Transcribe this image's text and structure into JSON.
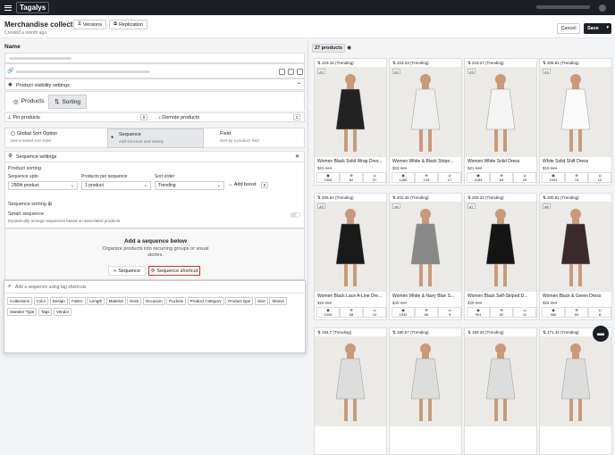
{
  "topbar": {
    "brand": "Tagalys"
  },
  "header": {
    "title": "Merchandise collection",
    "subtitle": "Created a month ago",
    "versions": "Versions",
    "replication": "Replication",
    "cancel": "Cancel",
    "save": "Save"
  },
  "left": {
    "name_label": "Name",
    "visibility": "Product visibility settings",
    "tabs": {
      "products": "Products",
      "sorting": "Sorting"
    },
    "pin": "Pin products",
    "pin_count": "0",
    "demote": "Demote products",
    "demote_count": "1",
    "sort_options": [
      {
        "title": "Global Sort Option",
        "sub": "Use a saved sort order"
      },
      {
        "title": "Sequence",
        "sub": "Add structure and variety"
      },
      {
        "title": "Field",
        "sub": "Sort by a product field"
      }
    ],
    "seq_settings": "Sequence settings",
    "product_sorting": "Product sorting",
    "seq_upto_label": "Sequence upto",
    "seq_upto_value": "250th product",
    "per_seq_label": "Products per sequence",
    "per_seq_value": "1 product",
    "sort_order_label": "Sort order",
    "sort_order_value": "Trending",
    "add_boost": "Add boost",
    "boost_count": "0",
    "seq_sorting": "Sequence sorting",
    "smart_seq": "Smart sequence",
    "smart_seq_sub": "Dynamically arrange sequences based on associated products.",
    "add_title": "Add a sequence below",
    "add_sub1": "Organize products into recurring groups or visual",
    "add_sub2": "stories.",
    "btn_sequence": "Sequence",
    "btn_shortcut": "Sequence shortcut",
    "search_placeholder": "Add a sequence using tag shortcuts",
    "tags": [
      "Collections",
      "Color",
      "Design",
      "Fabric",
      "Length",
      "Material",
      "Neck",
      "Occasion",
      "Pockets",
      "Product Category",
      "Product type",
      "Size",
      "Sleeve",
      "Sweater Type",
      "Tags",
      "Vendor"
    ]
  },
  "right": {
    "count": "27 products",
    "products": [
      {
        "tag": "219.16 (Trending)",
        "pos": "#1",
        "name": "Women Black Solid Wrap Dres...",
        "price": "$15",
        "old": "$19",
        "s": [
          "1306",
          "82",
          "37"
        ],
        "dress": "#222222"
      },
      {
        "tag": "219.23 (Trending)",
        "pos": "#2",
        "name": "Women White & Black Stripe...",
        "price": "$25",
        "old": "$29",
        "s": [
          "1466",
          "133",
          "17"
        ],
        "dress": "#eeeeee"
      },
      {
        "tag": "210.27 (Trending)",
        "pos": "#3",
        "name": "Women White Solid Dress",
        "price": "$21",
        "old": "$26",
        "s": [
          "1183",
          "63",
          "23"
        ],
        "dress": "#f5f5f5"
      },
      {
        "tag": "209.81 (Trending)",
        "pos": "#4",
        "name": "White Solid Shift Dress",
        "price": "$19",
        "old": "$24",
        "s": [
          "1024",
          "74",
          "12"
        ],
        "dress": "#fafafa"
      },
      {
        "tag": "206.64 (Trending)",
        "pos": "#5",
        "name": "Women Black Lace A-Line Dre...",
        "price": "$18",
        "old": "$20",
        "s": [
          "1096",
          "68",
          "10"
        ],
        "dress": "#1a1a1a"
      },
      {
        "tag": "202.46 (Trending)",
        "pos": "#6",
        "name": "Women White & Navy Blue S...",
        "price": "$40",
        "old": "$44",
        "s": [
          "1042",
          "66",
          "9"
        ],
        "dress": "#888888"
      },
      {
        "tag": "202.22 (Trending)",
        "pos": "#7",
        "name": "Women Black Self-Striped D...",
        "price": "$25",
        "old": "$30",
        "s": [
          "991",
          "52",
          "11"
        ],
        "dress": "#151515"
      },
      {
        "tag": "200.81 (Trending)",
        "pos": "#8",
        "name": "Women Black & Green Dress",
        "price": "$26",
        "old": "$33",
        "s": [
          "960",
          "59",
          "8"
        ],
        "dress": "#3a2a2e"
      },
      {
        "tag": "194.7 (Trending)",
        "pos": "",
        "name": "",
        "price": "",
        "old": "",
        "s": [
          "",
          "",
          ""
        ],
        "dress": "#dddddd"
      },
      {
        "tag": "190.67 (Trending)",
        "pos": "",
        "name": "",
        "price": "",
        "old": "",
        "s": [
          "",
          "",
          ""
        ],
        "dress": "#dddddd"
      },
      {
        "tag": "189.34 (Trending)",
        "pos": "",
        "name": "",
        "price": "",
        "old": "",
        "s": [
          "",
          "",
          ""
        ],
        "dress": "#dddddd"
      },
      {
        "tag": "171.44 (Trending)",
        "pos": "",
        "name": "",
        "price": "",
        "old": "",
        "s": [
          "",
          "",
          ""
        ],
        "dress": "#dddddd"
      }
    ]
  }
}
